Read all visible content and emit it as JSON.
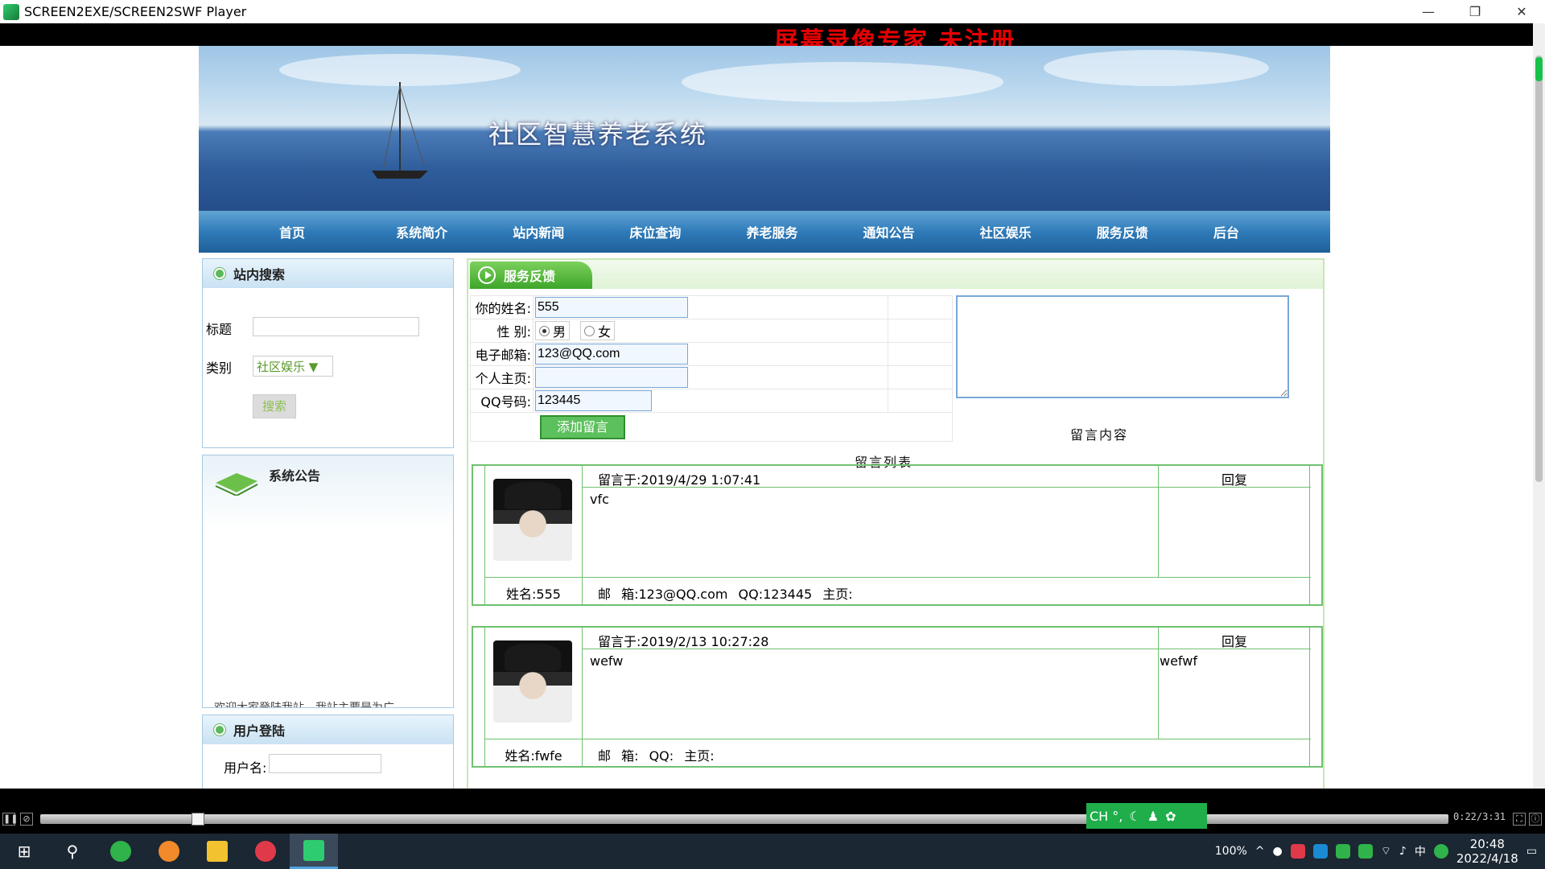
{
  "window": {
    "title": "SCREEN2EXE/SCREEN2SWF Player",
    "controls": [
      "—",
      "❐",
      "✕"
    ]
  },
  "watermark": "屏幕录像专家 未注册",
  "site": {
    "title": "社区智慧养老系统",
    "nav": [
      "首页",
      "系统简介",
      "站内新闻",
      "床位查询",
      "养老服务",
      "通知公告",
      "社区娱乐",
      "服务反馈",
      "后台"
    ]
  },
  "sidebar": {
    "search": {
      "heading": "站内搜索",
      "title_label": "标题",
      "title_value": "",
      "category_label": "类别",
      "category_value": "社区娱乐",
      "button": "搜索"
    },
    "notice": {
      "heading": "系统公告",
      "marquee": "欢迎大家登陆我站，我站主要是为广"
    },
    "login": {
      "heading": "用户登陆",
      "username_label": "用户名:",
      "username_value": ""
    }
  },
  "main": {
    "tab": "服务反馈",
    "form": {
      "name_label": "你的姓名:",
      "name_value": "555",
      "gender_label": "性 别:",
      "gender_male": "男",
      "gender_female": "女",
      "email_label": "电子邮箱:",
      "email_value": "123@QQ.com",
      "homepage_label": "个人主页:",
      "homepage_value": "",
      "qq_label": "QQ号码:",
      "qq_value": "123445",
      "submit": "添加留言",
      "message_value": "",
      "message_caption": "留言内容"
    },
    "list_caption": "留言列表",
    "entries": [
      {
        "time": "留言于:2019/4/29 1:07:41",
        "reply_label": "回复",
        "content": "vfc",
        "reply": "",
        "name": "姓名:555",
        "meta": "邮 箱:123@QQ.com QQ:123445 主页:"
      },
      {
        "time": "留言于:2019/2/13 10:27:28",
        "reply_label": "回复",
        "content": "wefw",
        "reply": "wefwf",
        "name": "姓名:fwfe",
        "meta": "邮 箱: QQ: 主页:"
      }
    ]
  },
  "player": {
    "time": "0:22/3:31"
  },
  "ime": "CH °,",
  "taskbar": {
    "battery": "100%",
    "lang": "中",
    "time": "20:48",
    "date": "2022/4/18"
  }
}
